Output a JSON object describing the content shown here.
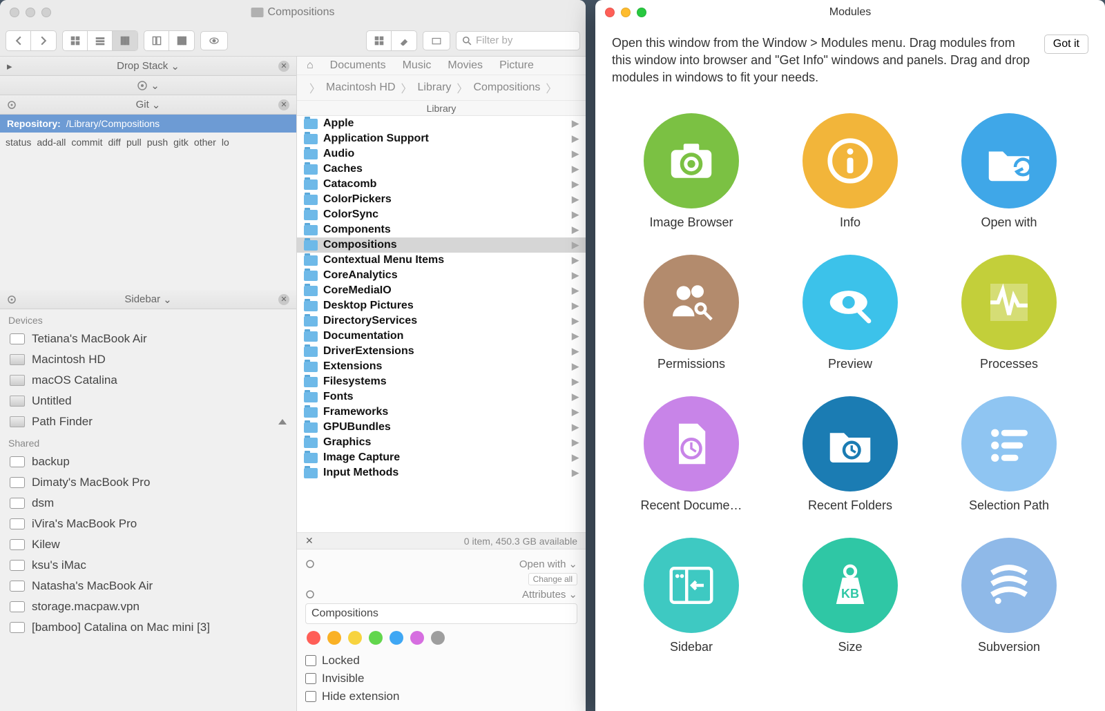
{
  "finder": {
    "title": "Compositions",
    "search_placeholder": "Filter by",
    "drop_stack": {
      "label": "Drop Stack"
    },
    "git": {
      "label": "Git",
      "repo_label": "Repository:",
      "repo_path": "/Library/Compositions",
      "actions": [
        "status",
        "add-all",
        "commit",
        "diff",
        "pull",
        "push",
        "gitk",
        "other",
        "lo"
      ]
    },
    "sidebar": {
      "label": "Sidebar",
      "sections": [
        {
          "title": "Devices",
          "items": [
            {
              "label": "Tetiana's MacBook Air",
              "icon": "laptop"
            },
            {
              "label": "Macintosh HD",
              "icon": "drive"
            },
            {
              "label": "macOS Catalina",
              "icon": "drive"
            },
            {
              "label": "Untitled",
              "icon": "drive"
            },
            {
              "label": "Path Finder",
              "icon": "drive",
              "eject": true
            }
          ]
        },
        {
          "title": "Shared",
          "items": [
            {
              "label": "backup",
              "icon": "server"
            },
            {
              "label": "Dimaty's MacBook Pro",
              "icon": "laptop"
            },
            {
              "label": "dsm",
              "icon": "server"
            },
            {
              "label": "iVira's MacBook Pro",
              "icon": "laptop"
            },
            {
              "label": "Kilew",
              "icon": "laptop"
            },
            {
              "label": "ksu's iMac",
              "icon": "laptop"
            },
            {
              "label": "Natasha's MacBook Air",
              "icon": "laptop"
            },
            {
              "label": "storage.macpaw.vpn",
              "icon": "display"
            },
            {
              "label": "[bamboo] Catalina on Mac mini [3]",
              "icon": "display"
            }
          ]
        }
      ]
    },
    "tabs_bar": [
      "Documents",
      "Music",
      "Movies",
      "Picture"
    ],
    "breadcrumb": [
      "Macintosh HD",
      "Library",
      "Compositions"
    ],
    "column_header": "Library",
    "folders": [
      "Apple",
      "Application Support",
      "Audio",
      "Caches",
      "Catacomb",
      "ColorPickers",
      "ColorSync",
      "Components",
      "Compositions",
      "Contextual Menu Items",
      "CoreAnalytics",
      "CoreMediaIO",
      "Desktop Pictures",
      "DirectoryServices",
      "Documentation",
      "DriverExtensions",
      "Extensions",
      "Filesystems",
      "Fonts",
      "Frameworks",
      "GPUBundles",
      "Graphics",
      "Image Capture",
      "Input Methods"
    ],
    "selected_folder": "Compositions",
    "status": "0 item, 450.3 GB available",
    "open_with_label": "Open with",
    "change_all_label": "Change all",
    "attributes_label": "Attributes",
    "attr_value": "Compositions",
    "tag_colors": [
      "#ff5e57",
      "#fab125",
      "#f7d33f",
      "#62d64d",
      "#3fa7f4",
      "#d66ee0",
      "#9e9e9e"
    ],
    "checks": {
      "locked": "Locked",
      "invisible": "Invisible",
      "hide_ext": "Hide extension"
    }
  },
  "modules": {
    "title": "Modules",
    "intro": "Open this window from the Window > Modules menu. Drag modules from this window into browser and \"Get Info\" windows and panels. Drag and drop modules in windows to fit your needs.",
    "got_it": "Got it",
    "items": [
      {
        "label": "Image Browser",
        "color": "#7bc143",
        "icon": "camera"
      },
      {
        "label": "Info",
        "color": "#f2b53a",
        "icon": "info"
      },
      {
        "label": "Open with",
        "color": "#3fa7e8",
        "icon": "folder-share"
      },
      {
        "label": "Permissions",
        "color": "#b38b6d",
        "icon": "people-key"
      },
      {
        "label": "Preview",
        "color": "#3cc2ea",
        "icon": "eye"
      },
      {
        "label": "Processes",
        "color": "#c3cf3a",
        "icon": "activity"
      },
      {
        "label": "Recent Docume…",
        "color": "#c884e8",
        "icon": "doc-clock"
      },
      {
        "label": "Recent Folders",
        "color": "#1b7cb3",
        "icon": "folder-clock"
      },
      {
        "label": "Selection Path",
        "color": "#8fc5f2",
        "icon": "lines"
      },
      {
        "label": "Sidebar",
        "color": "#3ec9c2",
        "icon": "sidebar"
      },
      {
        "label": "Size",
        "color": "#2fc7a5",
        "icon": "kb-weight"
      },
      {
        "label": "Subversion",
        "color": "#8fb9e8",
        "icon": "stripes"
      }
    ]
  }
}
